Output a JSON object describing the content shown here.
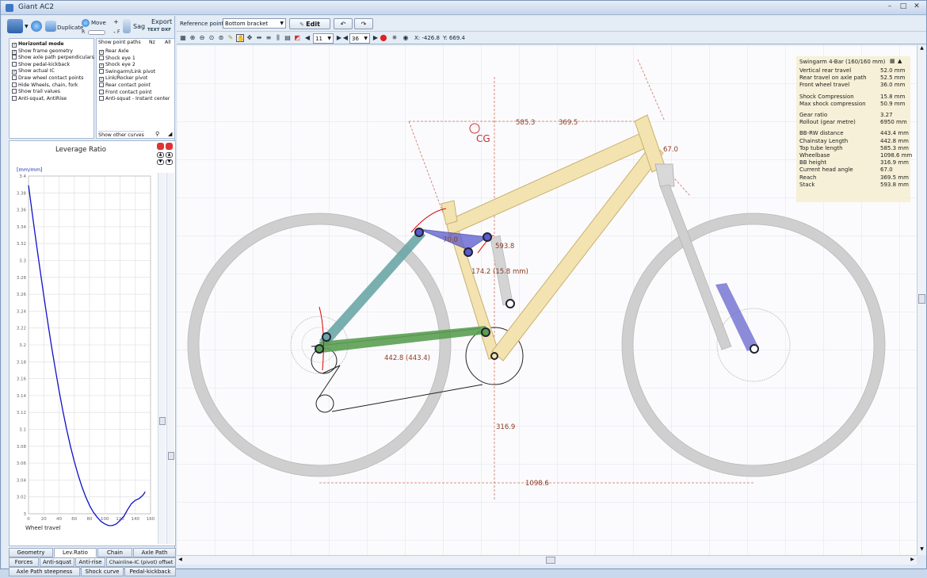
{
  "window": {
    "title": "Giant AC2"
  },
  "left_toolbar": {
    "duplicate_label": "Duplicate",
    "move_label": "Move",
    "sag_label": "Sag",
    "export_label": "Export",
    "export_sub": "TEXT DXF",
    "r_label": "R",
    "f_label": "F"
  },
  "options": [
    {
      "label": "Horizontal mode",
      "checked": true,
      "bold": true
    },
    {
      "label": "Show frame geometry",
      "checked": true
    },
    {
      "label": "Show axle path perpendiculars",
      "checked": false
    },
    {
      "label": "Show pedal-kickback",
      "checked": false
    },
    {
      "label": "Show actual IC",
      "checked": true
    },
    {
      "label": "Draw wheel contact points",
      "checked": false
    },
    {
      "label": "Hide Wheels, chain, fork",
      "checked": false
    },
    {
      "label": "Show trail values",
      "checked": false
    },
    {
      "label": "Anti-squat, AntiRise",
      "checked": false
    }
  ],
  "point_paths": {
    "header": "Show point paths",
    "col_nz": "Nz",
    "col_all": "All",
    "items": [
      {
        "label": "Rear Axle",
        "checked": true
      },
      {
        "label": "Shock eye 1",
        "checked": false
      },
      {
        "label": "Shock eye 2",
        "checked": true
      },
      {
        "label": "Swingarm/Link pivot",
        "checked": false
      },
      {
        "label": "Link/Rocker pivot",
        "checked": true
      },
      {
        "label": "Rear contact point",
        "checked": false
      },
      {
        "label": "Front contact point",
        "checked": false
      },
      {
        "label": "Anti-squat - Instant center",
        "checked": false
      }
    ],
    "other_curves": "Show other curves"
  },
  "leverage_plot": {
    "title": "Leverage Ratio",
    "unit": "[mm/mm]",
    "xlabel": "Wheel travel",
    "yticks": [
      "3.4",
      "3.38",
      "3.36",
      "3.34",
      "3.32",
      "3.3",
      "3.28",
      "3.26",
      "3.24",
      "3.22",
      "3.2",
      "3.18",
      "3.16",
      "3.14",
      "3.12",
      "3.1",
      "3.08",
      "3.06",
      "3.04",
      "3.02",
      "3"
    ],
    "xticks": [
      "0",
      "20",
      "40",
      "60",
      "80",
      "100",
      "120",
      "140",
      "160"
    ],
    "line_color": "#1010c8"
  },
  "bottom_tabs": {
    "row1": [
      "Geometry",
      "Lev.Ratio",
      "Chain",
      "Axle Path"
    ],
    "row2": [
      "Forces",
      "Anti-squat",
      "Anti-rise",
      "Chainline-IC (pivot) offset"
    ],
    "row3": [
      "Axle Path steepness",
      "Shock curve",
      "Pedal-kickback"
    ],
    "active": "Lev.Ratio"
  },
  "top_toolbar": {
    "reference_label": "Reference point",
    "reference_value": "Bottom bracket",
    "edit_label": "Edit",
    "front_cog": "11",
    "rear_cog": "36",
    "coord_x": "X: -426.8",
    "coord_y": "Y: 669.4"
  },
  "info_panel": {
    "title": "Swingarm 4-Bar (160/160 mm)",
    "groups": [
      [
        {
          "k": "Vertical rear travel",
          "v": "52.0 mm"
        },
        {
          "k": "Rear travel on axle path",
          "v": "52.5 mm"
        },
        {
          "k": "Front wheel travel",
          "v": "36.0 mm"
        }
      ],
      [
        {
          "k": "Shock Compression",
          "v": "15.8 mm"
        },
        {
          "k": "Max shock compression",
          "v": "50.9 mm"
        }
      ],
      [
        {
          "k": "Gear ratio",
          "v": "3.27"
        },
        {
          "k": "Rollout (gear metre)",
          "v": "6950 mm"
        }
      ],
      [
        {
          "k": "BB-RW distance",
          "v": "443.4 mm"
        },
        {
          "k": "Chainstay Length",
          "v": "442.8 mm"
        },
        {
          "k": "Top tube length",
          "v": "585.3 mm"
        },
        {
          "k": "Wheelbase",
          "v": "1098.6 mm"
        },
        {
          "k": "BB height",
          "v": "316.9 mm"
        },
        {
          "k": "Current head angle",
          "v": "67.0"
        },
        {
          "k": "Reach",
          "v": "369.5 mm"
        },
        {
          "k": "Stack",
          "v": "593.8 mm"
        }
      ]
    ]
  },
  "drawing_labels": {
    "cg": "CG",
    "top_tube": "585.3",
    "reach": "369.5",
    "head_angle": "67.0",
    "link_angle": "70.0",
    "stack": "593.8",
    "shock": "174.2 (15.8 mm)",
    "chainstay": "442.8 (443.4)",
    "bb_height": "316.9",
    "wheelbase": "1098.6"
  },
  "colors": {
    "frame": "#f3e3b0",
    "frame_edge": "#c9b070",
    "chainstay": "#5a9e52",
    "seatstay": "#6aa6a6",
    "link": "#5a5acf",
    "dim": "#8a3a22",
    "fork": "#5b5bc9"
  },
  "leverage_series": [
    [
      0,
      3.389
    ],
    [
      5,
      3.355
    ],
    [
      10,
      3.322
    ],
    [
      15,
      3.29
    ],
    [
      20,
      3.258
    ],
    [
      25,
      3.228
    ],
    [
      30,
      3.199
    ],
    [
      35,
      3.172
    ],
    [
      40,
      3.146
    ],
    [
      45,
      3.122
    ],
    [
      50,
      3.1
    ],
    [
      55,
      3.08
    ],
    [
      60,
      3.062
    ],
    [
      65,
      3.046
    ],
    [
      70,
      3.032
    ],
    [
      75,
      3.02
    ],
    [
      80,
      3.01
    ],
    [
      85,
      3.002
    ],
    [
      90,
      2.996
    ],
    [
      95,
      2.991
    ],
    [
      100,
      2.988
    ],
    [
      105,
      2.986
    ],
    [
      110,
      2.986
    ],
    [
      115,
      2.988
    ],
    [
      120,
      2.992
    ],
    [
      125,
      2.997
    ],
    [
      130,
      3.005
    ],
    [
      135,
      3.012
    ],
    [
      140,
      3.016
    ],
    [
      145,
      3.018
    ],
    [
      150,
      3.022
    ],
    [
      153,
      3.026
    ]
  ]
}
